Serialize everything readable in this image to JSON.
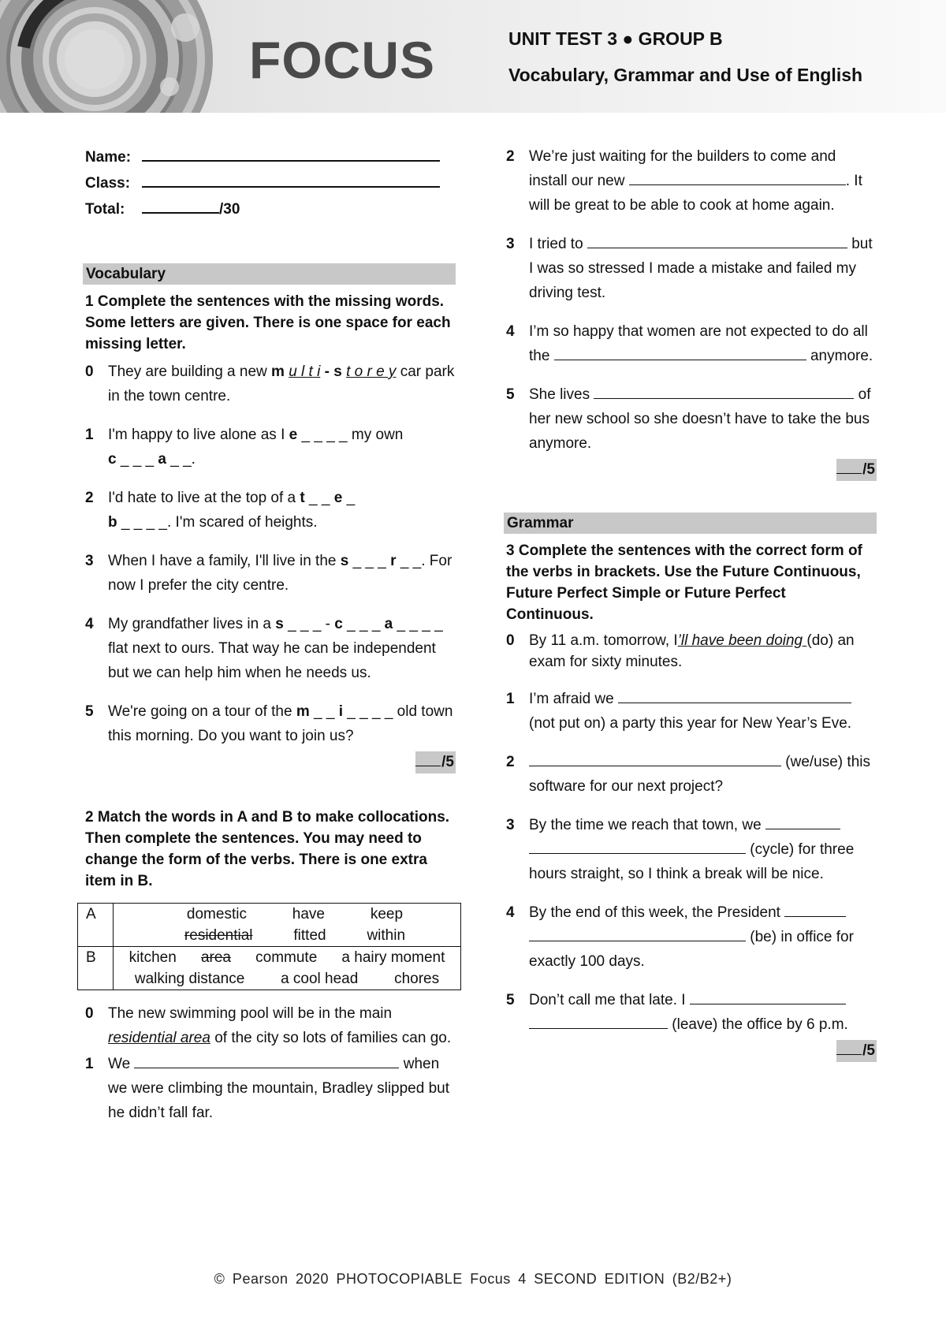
{
  "header": {
    "logo": "FOCUS",
    "unit_title": "UNIT TEST 3 ● GROUP B",
    "subtitle": "Vocabulary, Grammar and Use of English"
  },
  "student_info": {
    "name_label": "Name:",
    "class_label": "Class:",
    "total_label": "Total:",
    "total_max": "/30"
  },
  "vocabulary": {
    "section_title": "Vocabulary",
    "ex1": {
      "instruction": "1 Complete the sentences with the missing words. Some letters are given. There is one space for each missing letter.",
      "items": [
        {
          "num": "0",
          "before": "They are building a new ",
          "given_start": "m",
          "answer1": "u l t i",
          "dash": " - ",
          "given_mid": "s",
          "answer2": "t o r e y",
          "after": " car park in the town centre."
        },
        {
          "num": "1",
          "before": "I'm happy to live alone as I ",
          "g1": "e",
          "b1": " _ _ _ _ ",
          "mid": "my own ",
          "g2": "c",
          "b2": " _ _ _ ",
          "g3": "a",
          "b3": " _ _.",
          "after": ""
        },
        {
          "num": "2",
          "before": "I'd hate to live at the top of a  ",
          "g1": "t",
          "b1": " _ _ ",
          "g2": "e",
          "b2": " _ ",
          "g3": "b",
          "b3": " _ _ _ _",
          "after": ". I'm scared of heights."
        },
        {
          "num": "3",
          "before": "When I have a family, I'll live in the ",
          "g1": "s",
          "b1": " _ _ _ ",
          "g2": "r",
          "b2": " _ _.",
          "after": " For now I prefer the city centre."
        },
        {
          "num": "4",
          "before": "My grandfather lives in a ",
          "g1": "s",
          "b1": " _ _ _ - ",
          "g2": "c",
          "b2": " _ _ _ ",
          "g3": "a",
          "b3": " _ _ _ _",
          "after": " flat next to ours. That way he can be independent but we can help him when he needs us."
        },
        {
          "num": "5",
          "before": "We're going on a tour of the ",
          "g1": "m",
          "b1": " _ _ ",
          "g2": "i",
          "b2": " _ _ _ _ ",
          "after": "old town this morning. Do you want to join us?"
        }
      ],
      "score": "/5"
    },
    "ex2": {
      "instruction": "2 Match the words in A and B to make collocations. Then complete the sentences. You may need to change the form of the verbs. There is one extra item in B.",
      "table": {
        "row_a_label": "A",
        "row_a_line1": [
          "domestic",
          "have",
          "keep"
        ],
        "row_a_line2": [
          {
            "text": "residential",
            "struck": true
          },
          {
            "text": "fitted",
            "struck": false
          },
          {
            "text": "within",
            "struck": false
          }
        ],
        "row_b_label": "B",
        "row_b_line1": [
          {
            "text": "kitchen",
            "struck": false
          },
          {
            "text": "area",
            "struck": true
          },
          {
            "text": "commute",
            "struck": false
          },
          {
            "text": "a hairy moment",
            "struck": false
          }
        ],
        "row_b_line2": [
          "walking distance",
          "a cool head",
          "chores"
        ]
      },
      "items": [
        {
          "num": "0",
          "before": "The new swimming pool will be in the main ",
          "answer": "residential area",
          "after": " of the city so lots of families can go."
        },
        {
          "num": "1",
          "before": "We ",
          "after": " when we were climbing the mountain, Bradley slipped but he didn’t fall far."
        },
        {
          "num": "2",
          "before": "We’re just waiting for the builders to come and install our new ",
          "after": ". It will be great to be able to cook at home again."
        },
        {
          "num": "3",
          "before": "I tried to ",
          "after": " but I was so stressed I made a mistake and failed my driving test."
        },
        {
          "num": "4",
          "before": "I’m so happy that women are not expected to do all the ",
          "after": " anymore."
        },
        {
          "num": "5",
          "before": "She lives ",
          "after": " of her new school so she doesn’t have to take the bus anymore."
        }
      ],
      "score": "/5"
    }
  },
  "grammar": {
    "section_title": "Grammar",
    "ex3": {
      "instruction": "3 Complete the sentences with the correct form of the verbs in brackets. Use the Future Continuous, Future Perfect Simple or Future Perfect Continuous.",
      "items": [
        {
          "num": "0",
          "before": "By 11 a.m. tomorrow, I",
          "answer": "’ll have been doing ",
          "after": "(do) an exam for sixty minutes."
        },
        {
          "num": "1",
          "before": "I’m afraid we ",
          "after": " (not put on) a party this year for New Year’s Eve."
        },
        {
          "num": "2",
          "before": "",
          "after": " (we/use) this software for our next project?"
        },
        {
          "num": "3",
          "before": "By the time we reach that town, we ",
          "after": " (cycle) for three hours straight, so I think a break will be nice."
        },
        {
          "num": "4",
          "before": "By the end of this week, the President ",
          "after": " (be) in office for exactly 100 days."
        },
        {
          "num": "5",
          "before": "Don’t call me that late. I ",
          "after": " (leave) the office by 6 p.m."
        }
      ],
      "score": "/5"
    }
  },
  "footer": {
    "text": "© Pearson   2020   PHOTOCOPIABLE   Focus 4 SECOND EDITION (B2/B2+)"
  }
}
